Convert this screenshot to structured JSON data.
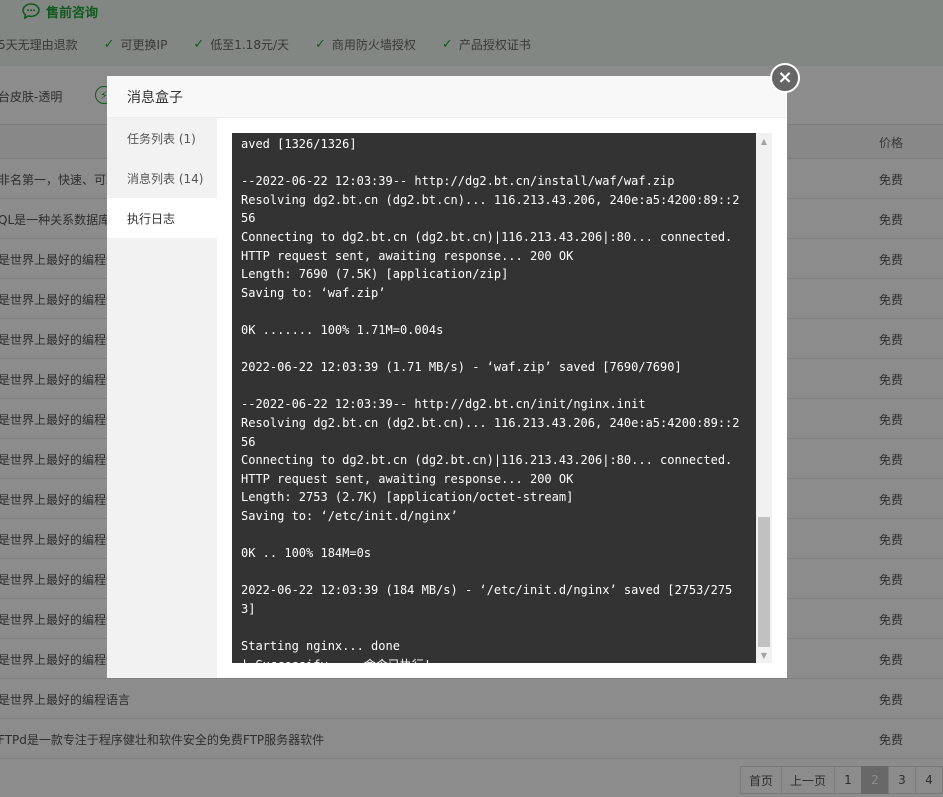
{
  "header": {
    "consult_label": "售前咨询",
    "features": [
      "5天无理由退款",
      "可更换IP",
      "低至1.18元/天",
      "商用防火墙授权",
      "产品授权证书"
    ]
  },
  "theme": {
    "label": "台皮肤-透明"
  },
  "table": {
    "price_header": "价格",
    "rows": [
      {
        "desc": "非名第一，快速、可靠",
        "price": "免费"
      },
      {
        "desc": "QL是一种关系数据库",
        "price": "免费"
      },
      {
        "desc": "是世界上最好的编程语言",
        "price": "免费"
      },
      {
        "desc": "是世界上最好的编程语言",
        "price": "免费"
      },
      {
        "desc": "是世界上最好的编程语言",
        "price": "免费"
      },
      {
        "desc": "是世界上最好的编程语言",
        "price": "免费"
      },
      {
        "desc": "是世界上最好的编程语言",
        "price": "免费"
      },
      {
        "desc": "是世界上最好的编程语言",
        "price": "免费"
      },
      {
        "desc": "是世界上最好的编程语言",
        "price": "免费"
      },
      {
        "desc": "是世界上最好的编程语言",
        "price": "免费"
      },
      {
        "desc": "是世界上最好的编程语言",
        "price": "免费"
      },
      {
        "desc": "是世界上最好的编程语言",
        "price": "免费"
      },
      {
        "desc": "是世界上最好的编程语言",
        "price": "免费"
      },
      {
        "desc": "是世界上最好的编程语言",
        "price": "免费"
      },
      {
        "desc": "FTPd是一款专注于程序健壮和软件安全的免费FTP服务器软件",
        "price": "免费"
      }
    ]
  },
  "pager": {
    "first": "首页",
    "prev": "上一页",
    "pages": [
      "1",
      "2",
      "3",
      "4"
    ],
    "current": "2"
  },
  "modal": {
    "title": "消息盒子",
    "close": "×",
    "tabs": [
      "任务列表 (1)",
      "消息列表 (14)",
      "执行日志"
    ],
    "active_tab": 2,
    "log": "aved [1326/1326]\n\n--2022-06-22 12:03:39-- http://dg2.bt.cn/install/waf/waf.zip\nResolving dg2.bt.cn (dg2.bt.cn)... 116.213.43.206, 240e:a5:4200:89::256\nConnecting to dg2.bt.cn (dg2.bt.cn)|116.213.43.206|:80... connected.\nHTTP request sent, awaiting response... 200 OK\nLength: 7690 (7.5K) [application/zip]\nSaving to: ‘waf.zip’\n\n0K ....... 100% 1.71M=0.004s\n\n2022-06-22 12:03:39 (1.71 MB/s) - ‘waf.zip’ saved [7690/7690]\n\n--2022-06-22 12:03:39-- http://dg2.bt.cn/init/nginx.init\nResolving dg2.bt.cn (dg2.bt.cn)... 116.213.43.206, 240e:a5:4200:89::256\nConnecting to dg2.bt.cn (dg2.bt.cn)|116.213.43.206|:80... connected.\nHTTP request sent, awaiting response... 200 OK\nLength: 2753 (2.7K) [application/octet-stream]\nSaving to: ‘/etc/init.d/nginx’\n\n0K .. 100% 184M=0s\n\n2022-06-22 12:03:39 (184 MB/s) - ‘/etc/init.d/nginx’ saved [2753/2753]\n\nStarting nginx... done\n|-Successify --- 命令已执行! ---"
  },
  "icons": {
    "consult": "chat-bubble-icon",
    "check": "check-icon",
    "bolt": "bolt-icon",
    "close": "close-icon"
  },
  "colors": {
    "accent": "#20a53a",
    "terminal_bg": "#333333",
    "pager_active": "#bdbdbd"
  }
}
